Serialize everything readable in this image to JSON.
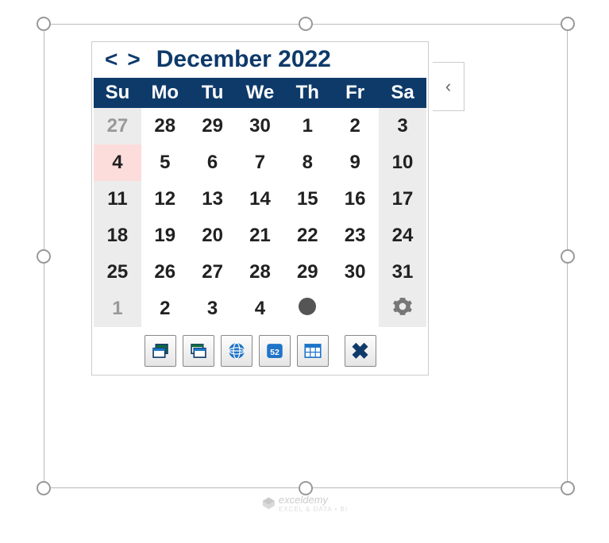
{
  "month_title": "December 2022",
  "day_headers": [
    "Su",
    "Mo",
    "Tu",
    "We",
    "Th",
    "Fr",
    "Sa"
  ],
  "rows": [
    [
      {
        "d": "27",
        "grey": true,
        "weekend": true
      },
      {
        "d": "28",
        "grey": true
      },
      {
        "d": "29",
        "grey": true
      },
      {
        "d": "30",
        "grey": true
      },
      {
        "d": "1"
      },
      {
        "d": "2"
      },
      {
        "d": "3",
        "weekend": true
      }
    ],
    [
      {
        "d": "4",
        "today": true,
        "weekend": true
      },
      {
        "d": "5"
      },
      {
        "d": "6"
      },
      {
        "d": "7"
      },
      {
        "d": "8"
      },
      {
        "d": "9"
      },
      {
        "d": "10",
        "weekend": true
      }
    ],
    [
      {
        "d": "11",
        "weekend": true
      },
      {
        "d": "12"
      },
      {
        "d": "13"
      },
      {
        "d": "14"
      },
      {
        "d": "15"
      },
      {
        "d": "16"
      },
      {
        "d": "17",
        "weekend": true
      }
    ],
    [
      {
        "d": "18",
        "weekend": true
      },
      {
        "d": "19"
      },
      {
        "d": "20"
      },
      {
        "d": "21"
      },
      {
        "d": "22"
      },
      {
        "d": "23"
      },
      {
        "d": "24",
        "weekend": true
      }
    ],
    [
      {
        "d": "25",
        "weekend": true
      },
      {
        "d": "26"
      },
      {
        "d": "27"
      },
      {
        "d": "28"
      },
      {
        "d": "29"
      },
      {
        "d": "30"
      },
      {
        "d": "31",
        "weekend": true
      }
    ],
    [
      {
        "d": "1",
        "grey": true,
        "weekend": true
      },
      {
        "d": "2",
        "grey": true
      },
      {
        "d": "3",
        "grey": true
      },
      {
        "d": "4",
        "grey": true
      },
      {
        "icon": "clock"
      },
      {
        "d": ""
      },
      {
        "icon": "gear",
        "weekend": true
      }
    ]
  ],
  "nav": {
    "prev": "<",
    "next": ">"
  },
  "collapse_label": "‹",
  "watermark": {
    "main": "exceldemy",
    "sub": "EXCEL & DATA • BI"
  }
}
